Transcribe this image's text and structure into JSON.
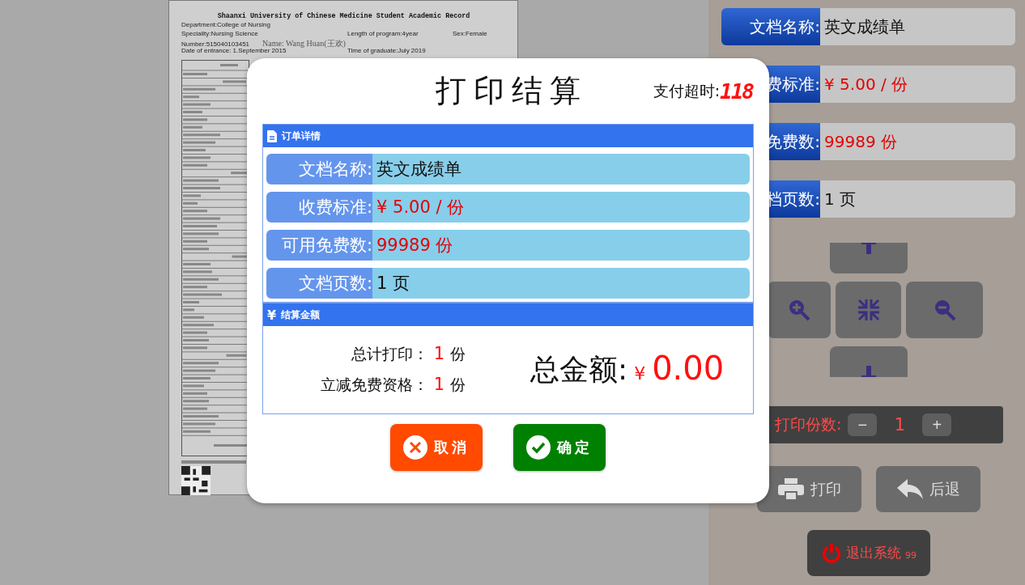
{
  "document": {
    "title": "Shaanxi University of Chinese Medicine Student Academic Record",
    "department": "Department:College of Nursing",
    "speciality": "Speciality:Nursing Science",
    "length": "Length of program:4year",
    "sex": "Sex:Female",
    "number": "Number:515040103451",
    "name": "Name: Wang Huan(王欢)",
    "entrance": "Date of entrance: 1.September 2015",
    "graduate": "Time of graduate:July 2019"
  },
  "side_panel": {
    "fields": [
      {
        "label": "文档名称:",
        "value": "英文成绩单",
        "emphasis": false
      },
      {
        "label": "费标准:",
        "value": "¥ 5.00 / 份",
        "emphasis": true
      },
      {
        "label": "免费数:",
        "value": "99989 份",
        "emphasis": true
      },
      {
        "label": "档页数:",
        "value": "1 页",
        "emphasis": false
      }
    ],
    "copies": {
      "label": "打印份数:",
      "minus": "−",
      "value": "1",
      "plus": "+"
    },
    "print_button": "打印",
    "back_button": "后退",
    "exit_button": {
      "label": "退出系统",
      "badge": "99"
    }
  },
  "dialog": {
    "title": "打印结算",
    "timeout_label": "支付超时:",
    "timeout": "118",
    "order_section": {
      "title": "订单详情",
      "rows": [
        {
          "label": "文档名称:",
          "value": "英文成绩单",
          "emphasis": false
        },
        {
          "label": "收费标准:",
          "value": "¥ 5.00 / 份",
          "emphasis": true
        },
        {
          "label": "可用免费数:",
          "value": "99989 份",
          "emphasis": true
        },
        {
          "label": "文档页数:",
          "value": "1 页",
          "emphasis": false
        }
      ]
    },
    "payment_section": {
      "icon": "¥",
      "title": "结算金额",
      "lines": [
        {
          "label": "总计打印：",
          "count": "1",
          "unit": "份"
        },
        {
          "label": "立减免费资格：",
          "count": "1",
          "unit": "份"
        }
      ],
      "total_label": "总金额:",
      "total_currency": "¥",
      "total_value": "0.00"
    },
    "cancel_button": "取消",
    "confirm_button": "确定"
  }
}
